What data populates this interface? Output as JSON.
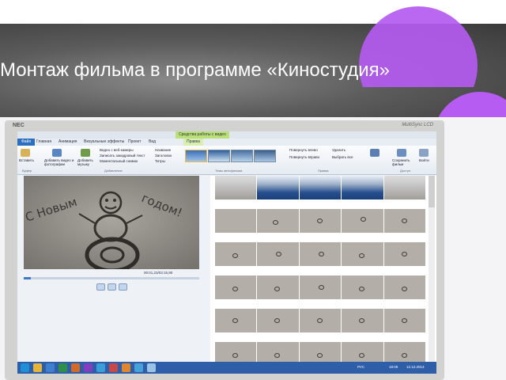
{
  "slide": {
    "title": "Монтаж фильма в программе «Киностудия»"
  },
  "monitor": {
    "brand": "NEC",
    "model": "MultiSync LCD"
  },
  "app": {
    "tools_badge": "Средства работы с видео",
    "tabs": [
      {
        "label": "Файл"
      },
      {
        "label": "Главная"
      },
      {
        "label": "Анимация"
      },
      {
        "label": "Визуальные эффекты"
      },
      {
        "label": "Проект"
      },
      {
        "label": "Вид"
      },
      {
        "label": "Правка"
      }
    ],
    "ribbon": {
      "paste": "Вставить",
      "add_video": "Добавить видео и фотографии",
      "add_music": "Добавить музыку",
      "webcam": "Видео с веб-камеры",
      "narration": "Записать закадровый текст",
      "snapshot": "Моментальный снимок",
      "title": "Название",
      "caption": "Заголовок",
      "credits": "Титры",
      "rotate_left": "Повернуть влево",
      "rotate_right": "Повернуть вправо",
      "delete": "Удалить",
      "select_all": "Выбрать все",
      "save_movie": "Сохранить фильм",
      "sign_in": "Войти",
      "groups": {
        "clipboard": "Буфер",
        "add": "Добавление",
        "themes": "Темы автофильма",
        "edit": "Правка",
        "share": "Доступ"
      }
    },
    "preview": {
      "time": "00:01,23/03:15,90"
    },
    "taskbar": {
      "clock": "18:09",
      "date": "12.12.2013",
      "lang": "РУС"
    }
  },
  "colors": {
    "accent_purple": "#b45bf0",
    "ribbon_blue": "#2c6fbf",
    "tools_green": "#b9e07a",
    "taskbar_blue": "#2e5ea8"
  }
}
